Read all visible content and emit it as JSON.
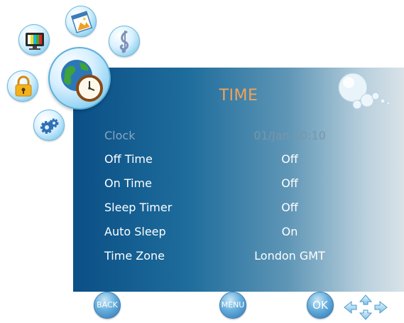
{
  "menu": {
    "title": "TIME",
    "rows": [
      {
        "label": "Clock",
        "value": "01/Jan  10:10",
        "enabled": false
      },
      {
        "label": "Off Time",
        "value": "Off",
        "enabled": true
      },
      {
        "label": "On Time",
        "value": "Off",
        "enabled": true
      },
      {
        "label": "Sleep Timer",
        "value": "Off",
        "enabled": true
      },
      {
        "label": "Auto Sleep",
        "value": "On",
        "enabled": true
      },
      {
        "label": "Time Zone",
        "value": "London GMT",
        "enabled": true
      }
    ]
  },
  "nav_icons": [
    "picture-icon",
    "photo-media-icon",
    "music-icon",
    "lock-icon",
    "time-icon",
    "setup-gear-icon"
  ],
  "buttons": {
    "back": "BACK",
    "menu": "MENU",
    "ok": "OK"
  },
  "colors": {
    "title": "#f3a257",
    "panel_dark": "#0b4f86",
    "panel_light": "#d9e3e8",
    "text": "#ffffff",
    "disabled": "#8aa6ba"
  }
}
